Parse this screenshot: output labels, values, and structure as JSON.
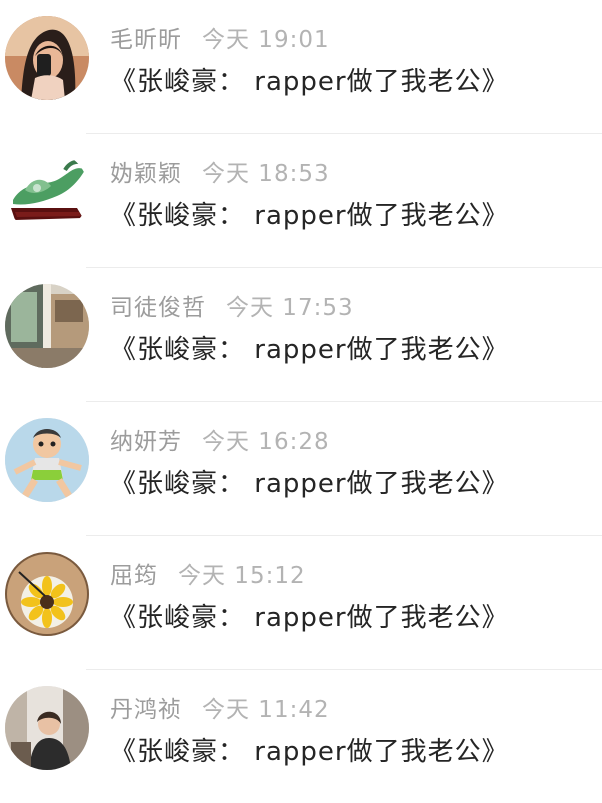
{
  "messages": [
    {
      "name": "毛昕昕",
      "time": "今天 19:01",
      "text": "《张峻豪： rapper做了我老公》",
      "avatar_icon": "girl-selfie-avatar"
    },
    {
      "name": "妫颖颖",
      "time": "今天 18:53",
      "text": "《张峻豪： rapper做了我老公》",
      "avatar_icon": "jade-cabbage-avatar"
    },
    {
      "name": "司徒俊哲",
      "time": "今天 17:53",
      "text": "《张峻豪： rapper做了我老公》",
      "avatar_icon": "room-window-avatar"
    },
    {
      "name": "纳妍芳",
      "time": "今天 16:28",
      "text": "《张峻豪： rapper做了我老公》",
      "avatar_icon": "cartoon-character-avatar"
    },
    {
      "name": "屈筠",
      "time": "今天 15:12",
      "text": "《张峻豪： rapper做了我老公》",
      "avatar_icon": "sunflower-avatar"
    },
    {
      "name": "丹鸿祯",
      "time": "今天 11:42",
      "text": "《张峻豪： rapper做了我老公》",
      "avatar_icon": "photo-person-avatar"
    }
  ]
}
